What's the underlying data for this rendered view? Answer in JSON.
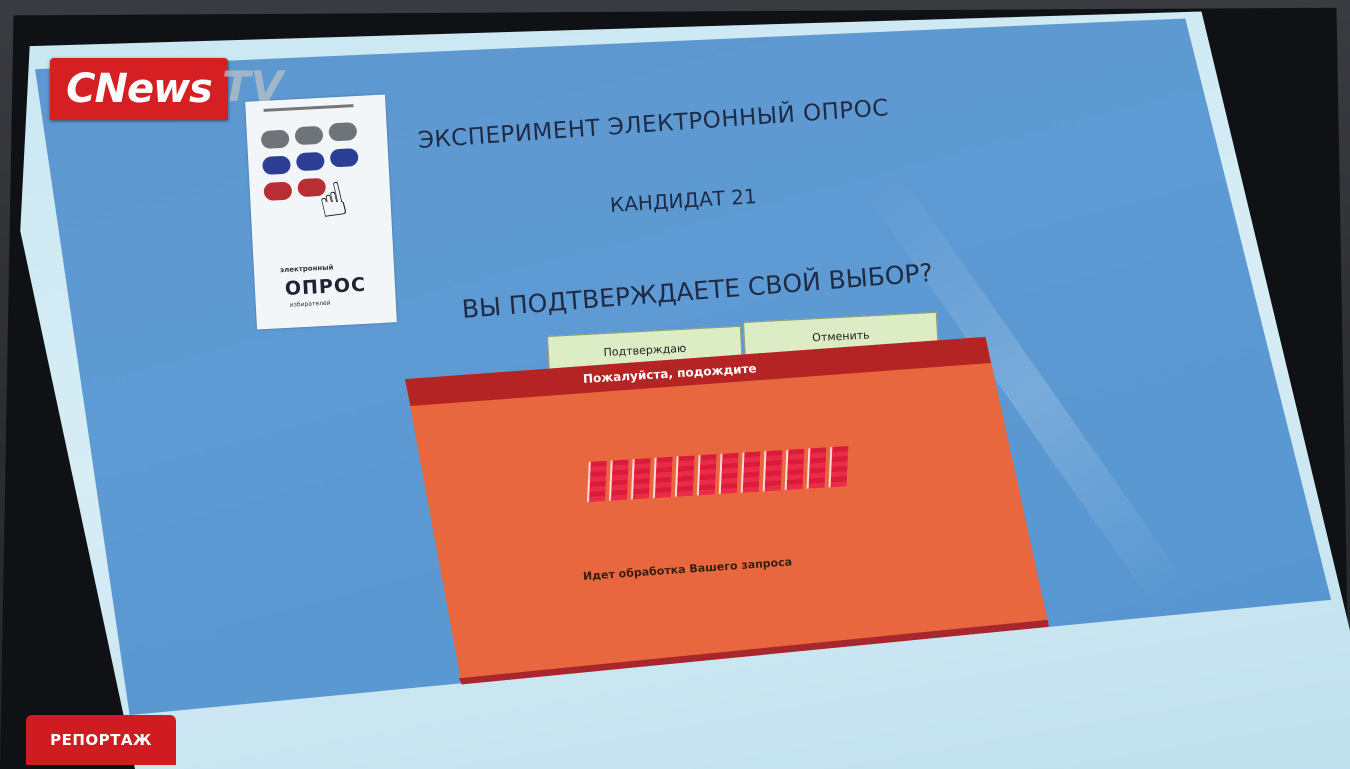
{
  "broadcast": {
    "logo": "CNews",
    "logo_suffix": "TV",
    "segment_tag": "РЕПОРТАЖ"
  },
  "screen": {
    "logo_card": {
      "caption_small": "электронный",
      "caption_big": "ОПРОС",
      "caption_sub": "избирателей"
    },
    "title": "ЭКСПЕРИМЕНТ ЭЛЕКТРОННЫЙ ОПРОС",
    "candidate": "КАНДИДАТ 21",
    "question": "ВЫ ПОДТВЕРЖДАЕТЕ СВОЙ ВЫБОР?",
    "buttons": {
      "confirm": "Подтверждаю",
      "cancel": "Отменить"
    },
    "dialog": {
      "title": "Пожалуйста, подождите",
      "status": "Идет обработка Вашего запроса"
    }
  },
  "colors": {
    "app_background": "#5d97cf",
    "dialog_background": "#e8673e",
    "dialog_title_bar": "#b42424",
    "button_background": "#dcecc4",
    "progress_fill": "#d91c3a",
    "brand_red": "#d61f23"
  }
}
